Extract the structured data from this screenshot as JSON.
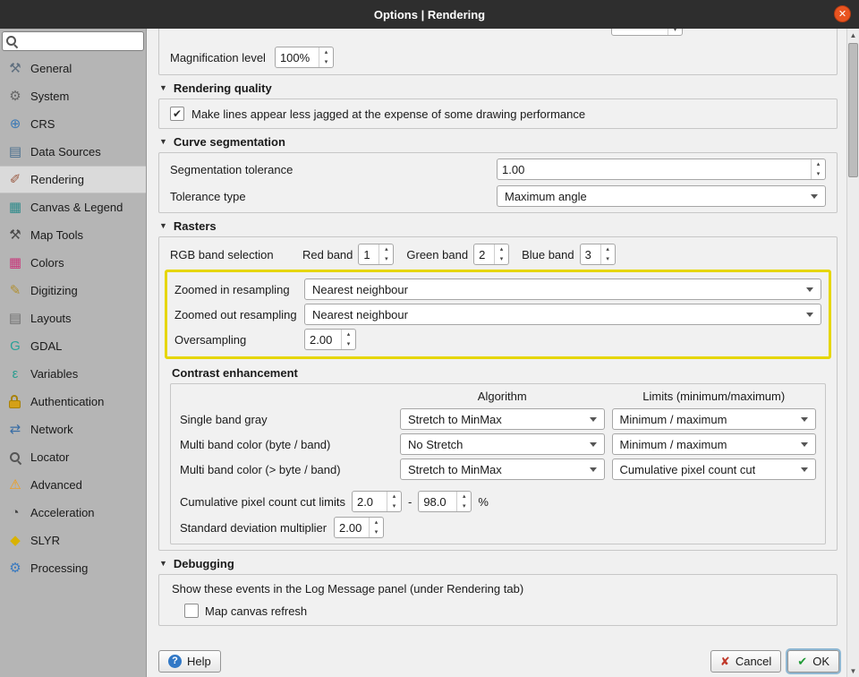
{
  "window": {
    "title": "Options | Rendering"
  },
  "icons": {
    "close": "✕",
    "spin_up": "▴",
    "spin_down": "▾",
    "check": "✔",
    "section_arrow": "▼",
    "scroll_up": "▲",
    "scroll_down": "▼",
    "help_q": "?",
    "cancel_x": "✘",
    "ok_check": "✔"
  },
  "sidebar": {
    "search": {
      "placeholder": "",
      "value": ""
    },
    "items": [
      {
        "label": "General",
        "icon": "tools-icon",
        "glyph": "⚒",
        "color": "#5f6f7f"
      },
      {
        "label": "System",
        "icon": "system-gear-icon",
        "glyph": "⚙",
        "color": "#666666"
      },
      {
        "label": "CRS",
        "icon": "globe-icon",
        "glyph": "⊕",
        "color": "#3d7ab5"
      },
      {
        "label": "Data Sources",
        "icon": "layers-icon",
        "glyph": "▤",
        "color": "#4a6f8f"
      },
      {
        "label": "Rendering",
        "icon": "paintbrush-icon",
        "glyph": "✐",
        "color": "#9a5a42",
        "selected": true
      },
      {
        "label": "Canvas & Legend",
        "icon": "canvas-legend-icon",
        "glyph": "▦",
        "color": "#2e8b8b"
      },
      {
        "label": "Map Tools",
        "icon": "wrench-icon",
        "glyph": "⚒",
        "color": "#4a4a4a"
      },
      {
        "label": "Colors",
        "icon": "colors-palette-icon",
        "glyph": "▦",
        "color": "#c8377b"
      },
      {
        "label": "Digitizing",
        "icon": "pencil-icon",
        "glyph": "✎",
        "color": "#b08f2f"
      },
      {
        "label": "Layouts",
        "icon": "layouts-page-icon",
        "glyph": "▤",
        "color": "#6f6f6f"
      },
      {
        "label": "GDAL",
        "icon": "gdal-icon",
        "glyph": "G",
        "color": "#2aa198"
      },
      {
        "label": "Variables",
        "icon": "variables-epsilon-icon",
        "glyph": "ε",
        "color": "#2a9d8f"
      },
      {
        "label": "Authentication",
        "icon": "lock-icon",
        "glyph": "",
        "color": "#d4a017"
      },
      {
        "label": "Network",
        "icon": "network-icon",
        "glyph": "⇄",
        "color": "#3a6ea5"
      },
      {
        "label": "Locator",
        "icon": "magnifier-icon",
        "glyph": "",
        "color": "#555555"
      },
      {
        "label": "Advanced",
        "icon": "warning-icon",
        "glyph": "⚠",
        "color": "#f39c12"
      },
      {
        "label": "Acceleration",
        "icon": "speedometer-icon",
        "glyph": "◔",
        "color": "#444444"
      },
      {
        "label": "SLYR",
        "icon": "slyr-icon",
        "glyph": "◆",
        "color": "#d9b200"
      },
      {
        "label": "Processing",
        "icon": "processing-gear-icon",
        "glyph": "⚙",
        "color": "#3a7abf"
      }
    ]
  },
  "main": {
    "magnification_label": "Magnification level",
    "magnification_value": "100%",
    "rendering_quality": {
      "title": "Rendering quality",
      "antialias_label": "Make lines appear less jagged at the expense of some drawing performance",
      "antialias_checked": true
    },
    "curve_segmentation": {
      "title": "Curve segmentation",
      "tolerance_label": "Segmentation tolerance",
      "tolerance_value": "1.00",
      "type_label": "Tolerance type",
      "type_value": "Maximum angle"
    },
    "rasters": {
      "title": "Rasters",
      "rgb_label": "RGB band selection",
      "red_label": "Red band",
      "red_value": "1",
      "green_label": "Green band",
      "green_value": "2",
      "blue_label": "Blue band",
      "blue_value": "3",
      "zoomed_in_label": "Zoomed in resampling",
      "zoomed_in_value": "Nearest neighbour",
      "zoomed_out_label": "Zoomed out resampling",
      "zoomed_out_value": "Nearest neighbour",
      "oversampling_label": "Oversampling",
      "oversampling_value": "2.00",
      "highlight_color": "#e6d600"
    },
    "contrast": {
      "title": "Contrast enhancement",
      "col_algorithm": "Algorithm",
      "col_limits": "Limits (minimum/maximum)",
      "rows": [
        {
          "label": "Single band gray",
          "algorithm": "Stretch to MinMax",
          "limits": "Minimum / maximum"
        },
        {
          "label": "Multi band color (byte / band)",
          "algorithm": "No Stretch",
          "limits": "Minimum / maximum"
        },
        {
          "label": "Multi band color (> byte / band)",
          "algorithm": "Stretch to MinMax",
          "limits": "Cumulative pixel count cut"
        }
      ],
      "cumulative_label": "Cumulative pixel count cut limits",
      "cumulative_min": "2.0",
      "cumulative_dash": "-",
      "cumulative_max": "98.0",
      "cumulative_unit": "%",
      "stddev_label": "Standard deviation multiplier",
      "stddev_value": "2.00"
    },
    "debugging": {
      "title": "Debugging",
      "info_label": "Show these events in the Log Message panel (under Rendering tab)",
      "map_refresh_label": "Map canvas refresh",
      "map_refresh_checked": false
    }
  },
  "footer": {
    "help": "Help",
    "cancel": "Cancel",
    "ok": "OK"
  }
}
